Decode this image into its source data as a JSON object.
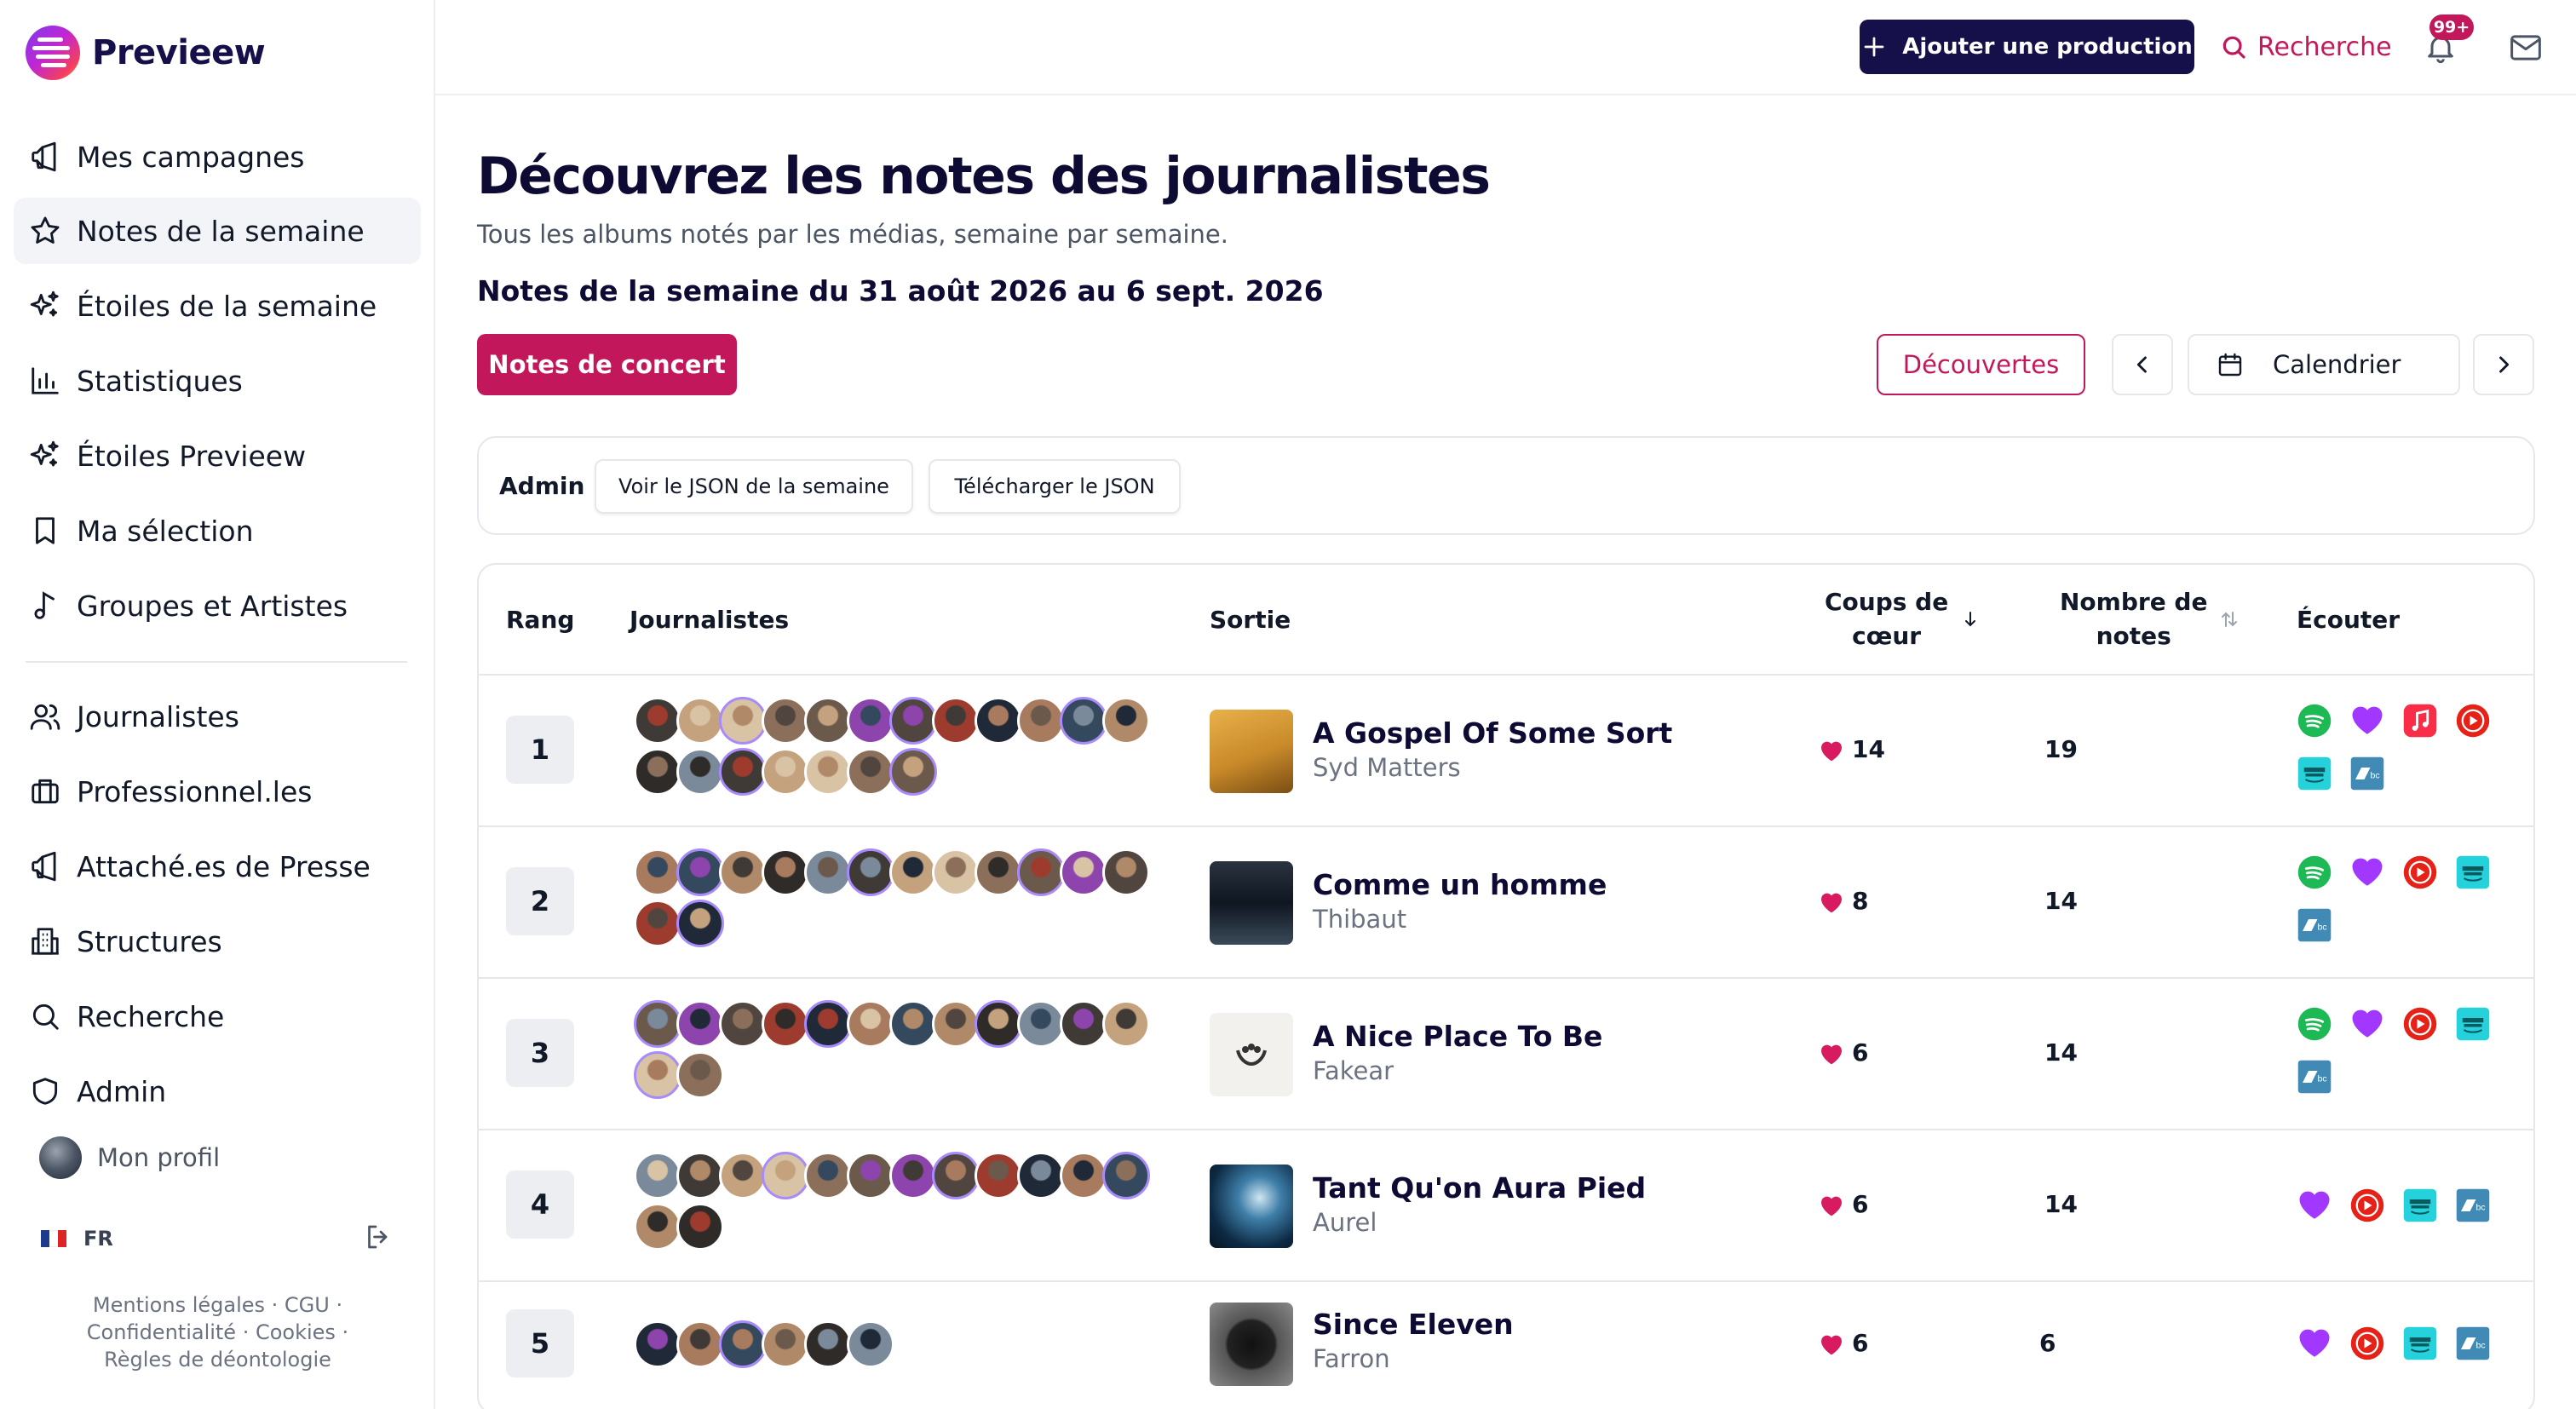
{
  "app": {
    "name": "Previeew"
  },
  "sidebar": {
    "items": [
      {
        "label": "Mes campagnes",
        "icon": "megaphone-icon"
      },
      {
        "label": "Notes de la semaine",
        "icon": "star-icon",
        "active": true
      },
      {
        "label": "Étoiles de la semaine",
        "icon": "sparkles-icon"
      },
      {
        "label": "Statistiques",
        "icon": "bar-chart-icon"
      },
      {
        "label": "Étoiles Previeew",
        "icon": "sparkles-icon"
      },
      {
        "label": "Ma sélection",
        "icon": "bookmark-icon"
      },
      {
        "label": "Groupes et Artistes",
        "icon": "music-note-icon"
      },
      {
        "label": "Journalistes",
        "icon": "users-icon"
      },
      {
        "label": "Professionnel.les",
        "icon": "briefcase-icon"
      },
      {
        "label": "Attaché.es de Presse",
        "icon": "megaphone-icon"
      },
      {
        "label": "Structures",
        "icon": "building-icon"
      },
      {
        "label": "Recherche",
        "icon": "search-icon"
      },
      {
        "label": "Admin",
        "icon": "shield-icon"
      }
    ],
    "profile_label": "Mon profil",
    "language": "FR",
    "legal": {
      "line1": "Mentions légales · CGU ·",
      "line2": "Confidentialité · Cookies ·",
      "line3": "Règles de déontologie"
    }
  },
  "header": {
    "add_button": "Ajouter une production",
    "search_label": "Recherche",
    "notifications_badge": "99+"
  },
  "page": {
    "title": "Découvrez les notes des journalistes",
    "subtitle": "Tous les albums notés par les médias, semaine par semaine.",
    "week_title": "Notes de la semaine du 31 août 2026 au 6 sept. 2026",
    "concert_button": "Notes de concert",
    "discoveries_button": "Découvertes",
    "calendar_button": "Calendrier"
  },
  "admin": {
    "label": "Admin",
    "view_json": "Voir le JSON de la semaine",
    "download_json": "Télécharger le JSON"
  },
  "table": {
    "headers": {
      "rank": "Rang",
      "journalists": "Journalistes",
      "release": "Sortie",
      "likes_line1": "Coups de",
      "likes_line2": "cœur",
      "notes_line1": "Nombre de",
      "notes_line2": "notes",
      "listen": "Écouter"
    },
    "rows": [
      {
        "rank": "1",
        "title": "A Gospel Of Some Sort",
        "artist": "Syd Matters",
        "likes": "14",
        "notes": "19",
        "journalist_count": 19,
        "platforms": [
          "spotify",
          "deezer",
          "apple-music",
          "youtube",
          "amazon-music",
          "bandcamp"
        ]
      },
      {
        "rank": "2",
        "title": "Comme un homme",
        "artist": "Thibaut",
        "likes": "8",
        "notes": "14",
        "journalist_count": 14,
        "platforms": [
          "spotify",
          "deezer",
          "youtube",
          "amazon-music",
          "bandcamp"
        ]
      },
      {
        "rank": "3",
        "title": "A Nice Place To Be",
        "artist": "Fakear",
        "likes": "6",
        "notes": "14",
        "journalist_count": 14,
        "platforms": [
          "spotify",
          "deezer",
          "youtube",
          "amazon-music",
          "bandcamp"
        ]
      },
      {
        "rank": "4",
        "title": "Tant Qu'on Aura Pied",
        "artist": "Aurel",
        "likes": "6",
        "notes": "14",
        "journalist_count": 14,
        "platforms": [
          "deezer",
          "youtube",
          "amazon-music",
          "bandcamp"
        ]
      },
      {
        "rank": "5",
        "title": "Since Eleven",
        "artist": "Farron",
        "likes": "6",
        "notes": "6",
        "journalist_count": 6,
        "platforms": [
          "deezer",
          "youtube",
          "amazon-music",
          "bandcamp"
        ]
      }
    ]
  },
  "colors": {
    "accent": "#c2185b",
    "navy": "#16104a",
    "muted": "#6b7280",
    "border": "#e5e7eb"
  }
}
